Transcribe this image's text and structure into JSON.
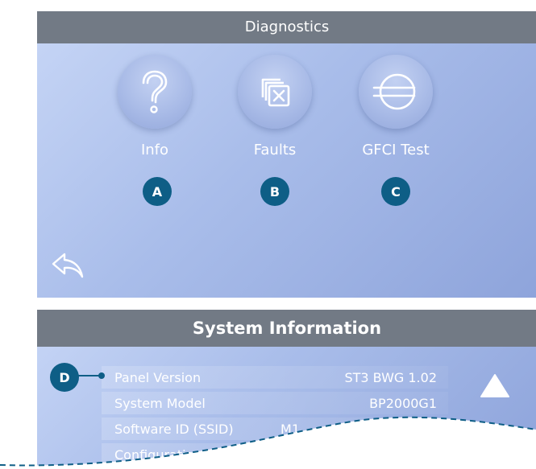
{
  "diagnostics": {
    "title": "Diagnostics",
    "tiles": [
      {
        "label": "Info",
        "icon": "question-icon",
        "badge": "A"
      },
      {
        "label": "Faults",
        "icon": "faults-icon",
        "badge": "B"
      },
      {
        "label": "GFCI Test",
        "icon": "gfci-icon",
        "badge": "C"
      }
    ],
    "back_icon": "back-arrow-icon"
  },
  "system_information": {
    "title": "System Information",
    "callout_badge": "D",
    "rows": [
      {
        "label": "Panel Version",
        "value": "ST3 BWG 1.02"
      },
      {
        "label": "System Model",
        "value": "BP2000G1"
      },
      {
        "label": "Software ID (SSID)",
        "value": "M1"
      },
      {
        "label": "Configuration Si",
        "value": ""
      }
    ],
    "scroll_up_icon": "triangle-up-icon"
  },
  "colors": {
    "header": "#727a85",
    "panel": "#a9bdea",
    "badge": "#0e5e86",
    "text": "#ffffff"
  }
}
